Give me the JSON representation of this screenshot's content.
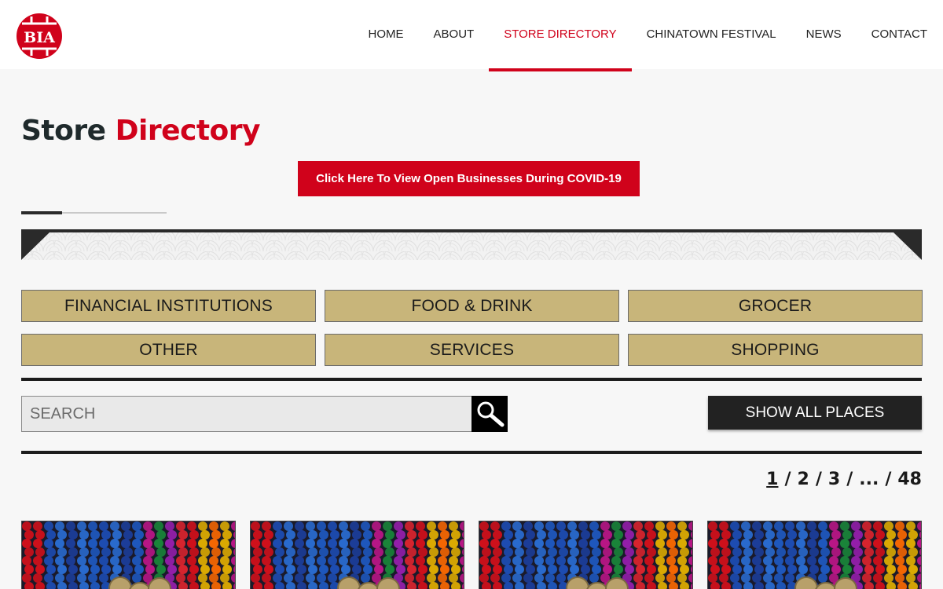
{
  "logo": {
    "text": "BIA",
    "color": "#d0021b"
  },
  "nav": {
    "items": [
      {
        "label": "HOME",
        "active": false
      },
      {
        "label": "ABOUT",
        "active": false
      },
      {
        "label": "STORE DIRECTORY",
        "active": true
      },
      {
        "label": "CHINATOWN FESTIVAL",
        "active": false
      },
      {
        "label": "NEWS",
        "active": false
      },
      {
        "label": "CONTACT",
        "active": false
      }
    ]
  },
  "page": {
    "title_part1": "Store",
    "title_part2": "Directory",
    "covid_button": "Click Here To View Open Businesses During COVID-19"
  },
  "categories": [
    "FINANCIAL INSTITUTIONS",
    "FOOD & DRINK",
    "GROCER",
    "OTHER",
    "SERVICES",
    "SHOPPING"
  ],
  "search": {
    "placeholder": "SEARCH",
    "value": ""
  },
  "show_all_label": "SHOW ALL PLACES",
  "pagination": {
    "p1": "1",
    "p2": "2",
    "p3": "3",
    "ellipsis": "...",
    "last": "48",
    "separator": "/"
  },
  "cards_count_visible": 4,
  "colors": {
    "accent": "#d0021b",
    "category_bg": "#c8b57a",
    "dark": "#222222"
  }
}
